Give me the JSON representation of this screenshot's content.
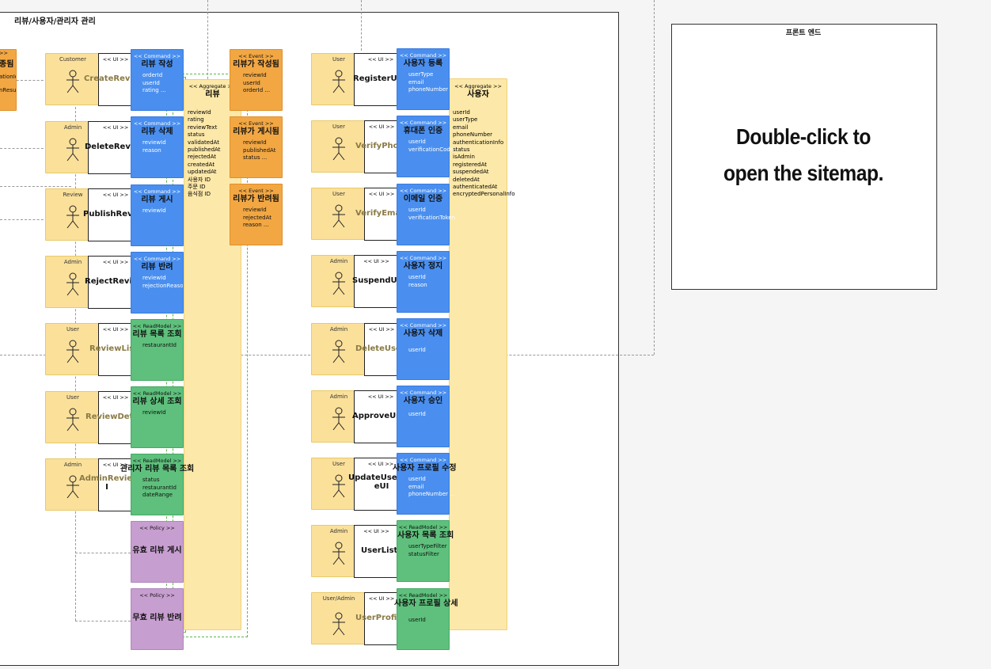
{
  "frames": {
    "main_title": "리뷰/사용자/관리자 관리",
    "frontend_title": "프론트 엔드",
    "frontend_hint_line1": "Double-click to",
    "frontend_hint_line2": "open the sitemap."
  },
  "left_partial": {
    "stereo": ">>",
    "title": "종됨",
    "attr1": "ationId",
    "attr2": "nResult"
  },
  "review_actors": [
    {
      "label": "Customer"
    },
    {
      "label": "Admin"
    },
    {
      "label": "Review"
    },
    {
      "label": "Admin"
    },
    {
      "label": "User"
    },
    {
      "label": "User"
    },
    {
      "label": "Admin"
    }
  ],
  "review_uis": [
    {
      "stereo": "<< UI >>",
      "label": "CreateReview"
    },
    {
      "stereo": "<< UI >>",
      "label": "DeleteReview"
    },
    {
      "stereo": "<< UI >>",
      "label": "PublishReviewUI"
    },
    {
      "stereo": "<< UI >>",
      "label": "RejectReviewUI"
    },
    {
      "stereo": "<< UI >>",
      "label": "ReviewList"
    },
    {
      "stereo": "<< UI >>",
      "label": "ReviewDeta"
    },
    {
      "stereo": "<< UI >>",
      "label": "AdminReview",
      "label2": "I"
    }
  ],
  "review_commands": [
    {
      "stereo": "<< Command >>",
      "title": "리뷰 작성",
      "attrs": [
        "orderId",
        "userId",
        "rating ..."
      ]
    },
    {
      "stereo": "<< Command >>",
      "title": "리뷰 삭제",
      "attrs": [
        "reviewId",
        "reason"
      ]
    },
    {
      "stereo": "<< Command >>",
      "title": "리뷰 게시",
      "attrs": [
        "reviewId"
      ]
    },
    {
      "stereo": "<< Command >>",
      "title": "리뷰 반려",
      "attrs": [
        "reviewId",
        "rejectionReason"
      ]
    }
  ],
  "review_readmodels": [
    {
      "stereo": "<< ReadModel >>",
      "title": "리뷰 목록 조회",
      "attrs": [
        "restaurantId"
      ]
    },
    {
      "stereo": "<< ReadModel >>",
      "title": "리뷰 상세 조회",
      "attrs": [
        "reviewId"
      ]
    },
    {
      "stereo": "<< ReadModel >>",
      "title": "관리자 리뷰 목록 조회",
      "attrs": [
        "status",
        "restaurantId",
        "dateRange"
      ]
    }
  ],
  "review_policies": [
    {
      "stereo": "<< Policy >>",
      "title": "유효 리뷰 게시"
    },
    {
      "stereo": "<< Policy >>",
      "title": "무효 리뷰 반려"
    }
  ],
  "review_aggregate": {
    "stereo": "<< Aggregate >>",
    "title": "리뷰",
    "attrs": [
      "reviewId",
      "rating",
      "reviewText",
      "status",
      "validatedAt",
      "publishedAt",
      "rejectedAt",
      "createdAt",
      "updatedAt",
      "사용자 ID",
      "주문 ID",
      "음식점 ID"
    ]
  },
  "review_events": [
    {
      "stereo": "<< Event >>",
      "title": "리뷰가 작성됨",
      "attrs": [
        "reviewId",
        "userId",
        "orderId ..."
      ]
    },
    {
      "stereo": "<< Event >>",
      "title": "리뷰가 게시됨",
      "attrs": [
        "reviewId",
        "publishedAt",
        "status ..."
      ]
    },
    {
      "stereo": "<< Event >>",
      "title": "리뷰가 반려됨",
      "attrs": [
        "reviewId",
        "rejectedAt",
        "reason ..."
      ]
    }
  ],
  "user_actors": [
    {
      "label": "User"
    },
    {
      "label": "User"
    },
    {
      "label": "User"
    },
    {
      "label": "Admin"
    },
    {
      "label": "Admin"
    },
    {
      "label": "Admin"
    },
    {
      "label": "User"
    },
    {
      "label": "Admin"
    },
    {
      "label": "User/Admin"
    }
  ],
  "user_uis": [
    {
      "stereo": "<< UI >>",
      "label": "RegisterUserUI"
    },
    {
      "stereo": "<< UI >>",
      "label": "VerifyPhone"
    },
    {
      "stereo": "<< UI >>",
      "label": "VerifyEmai"
    },
    {
      "stereo": "<< UI >>",
      "label": "SuspendUse"
    },
    {
      "stereo": "<< UI >>",
      "label": "DeleteUser"
    },
    {
      "stereo": "<< UI >>",
      "label": "ApproveUserUI"
    },
    {
      "stereo": "<< UI >>",
      "label": "UpdateUserProfil",
      "label2": "eUI"
    },
    {
      "stereo": "<< UI >>",
      "label": "UserListU"
    },
    {
      "stereo": "<< UI >>",
      "label": "UserProfile"
    }
  ],
  "user_commands": [
    {
      "stereo": "<< Command >>",
      "title": "사용자 등록",
      "attrs": [
        "userType",
        "email",
        "phoneNumber ..."
      ]
    },
    {
      "stereo": "<< Command >>",
      "title": "휴대폰 인증",
      "attrs": [
        "userId",
        "verificationCode"
      ]
    },
    {
      "stereo": "<< Command >>",
      "title": "이메일 인증",
      "attrs": [
        "userId",
        "verificationToken"
      ]
    },
    {
      "stereo": "<< Command >>",
      "title": "사용자 정지",
      "attrs": [
        "userId",
        "reason"
      ]
    },
    {
      "stereo": "<< Command >>",
      "title": "사용자 삭제",
      "attrs": [
        "userId"
      ]
    },
    {
      "stereo": "<< Command >>",
      "title": "사용자 승인",
      "attrs": [
        "userId"
      ]
    },
    {
      "stereo": "<< Command >>",
      "title": "사용자 프로필 수정",
      "attrs": [
        "userId",
        "email",
        "phoneNumber ..."
      ]
    }
  ],
  "user_readmodels": [
    {
      "stereo": "<< ReadModel >>",
      "title": "사용자 목록 조회",
      "attrs": [
        "userTypeFilter",
        "statusFilter"
      ]
    },
    {
      "stereo": "<< ReadModel >>",
      "title": "사용자 프로필 상세",
      "attrs": [
        "userId"
      ]
    }
  ],
  "user_aggregate": {
    "stereo": "<< Aggregate >>",
    "title": "사용자",
    "attrs": [
      "userId",
      "userType",
      "email",
      "phoneNumber",
      "authenticationInfo",
      "status",
      "isAdmin",
      "registeredAt",
      "suspendedAt",
      "deletedAt",
      "authenticatedAt",
      "encryptedPersonalInfo"
    ]
  }
}
